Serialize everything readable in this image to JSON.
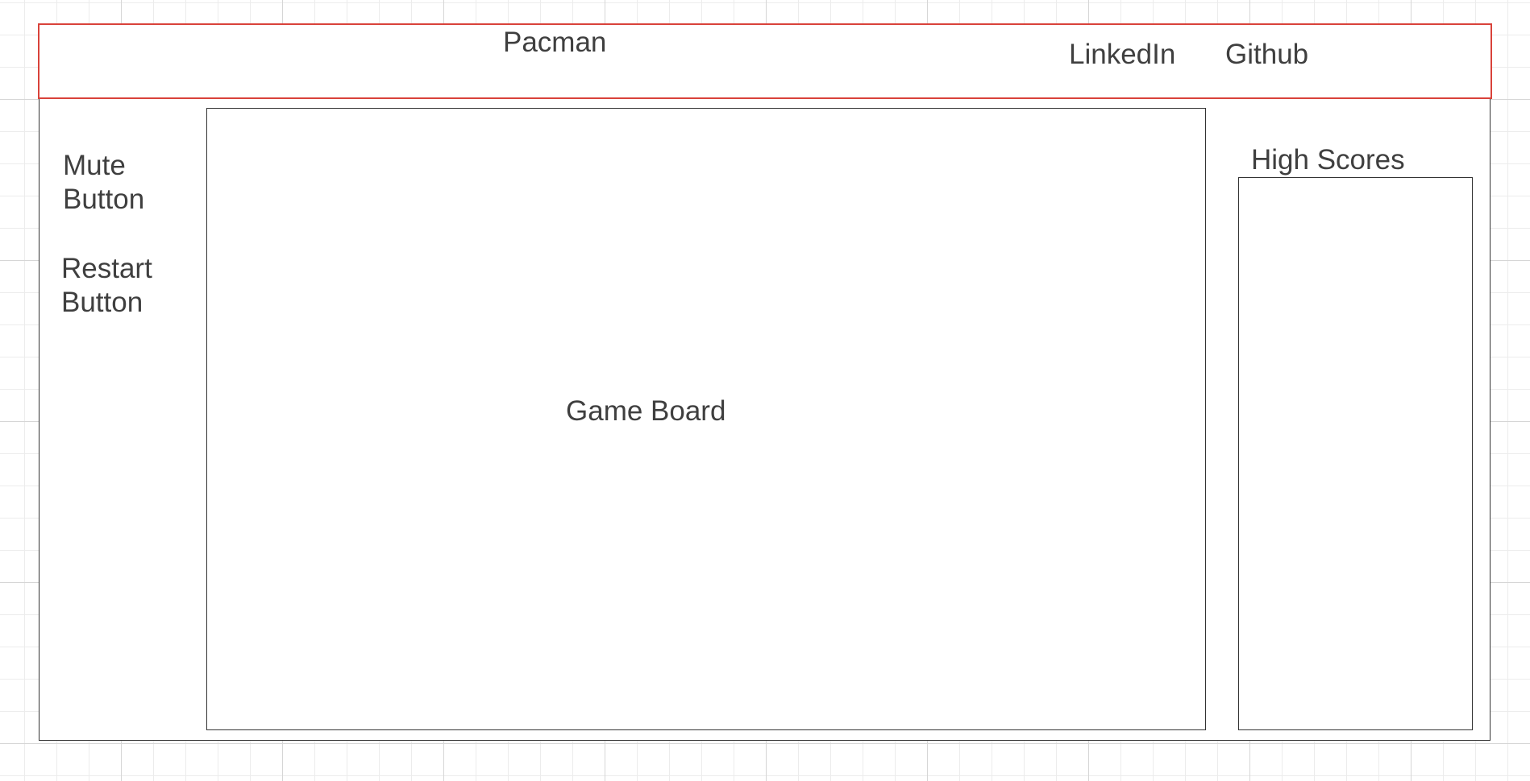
{
  "header": {
    "title": "Pacman",
    "links": [
      "LinkedIn",
      "Github"
    ]
  },
  "sidebar": {
    "mute_line1": "Mute",
    "mute_line2": "Button",
    "restart_line1": "Restart",
    "restart_line2": "Button"
  },
  "game_board": {
    "label": "Game Board"
  },
  "high_scores": {
    "title": "High Scores"
  },
  "colors": {
    "header_border": "#d9423a",
    "outline": "#333333",
    "text": "#3f3f3f",
    "grid": "#ececec"
  }
}
